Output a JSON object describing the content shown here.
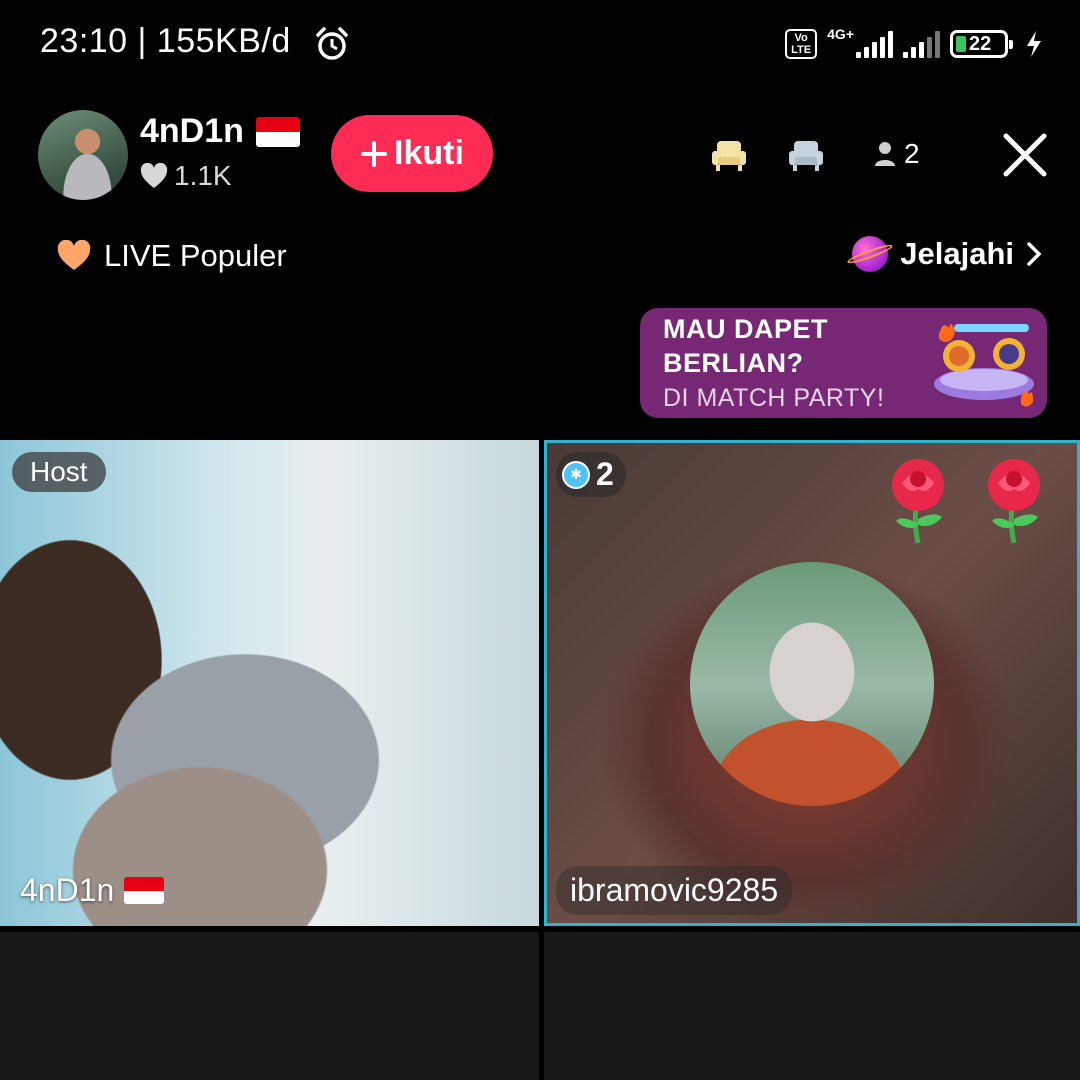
{
  "status_bar": {
    "time_speed": "23:10 | 155KB/d",
    "volte": "Vo LTE",
    "network": "4G+",
    "battery_level": "22"
  },
  "header": {
    "host_name": "4nD1n",
    "likes": "1.1K",
    "follow_label": "Ikuti",
    "viewer_count": "2",
    "live_popular": "LIVE Populer",
    "explore": "Jelajahi"
  },
  "promo": {
    "line1": "MAU DAPET",
    "line2": "BERLIAN?",
    "line3": "DI MATCH PARTY!"
  },
  "grid": {
    "host_badge": "Host",
    "guest_level": "2",
    "host_label": "4nD1n",
    "guest_label": "ibramovic9285"
  },
  "colors": {
    "follow": "#fe2c55",
    "promo_bg": "#762874",
    "guest_border": "#2fb4cf"
  }
}
